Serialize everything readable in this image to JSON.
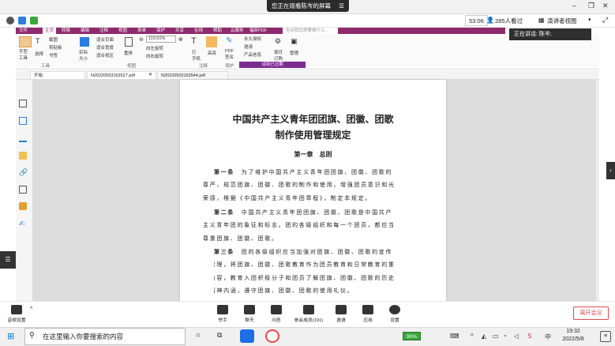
{
  "screen_share": {
    "banner_text": "您正在观看陈岑的屏幕",
    "menu_icon": "menu-icon"
  },
  "meeting_bar": {
    "timer": "53:06",
    "viewers": "285人看过",
    "speaker_view": "演讲者视图",
    "speaking_now": "正在讲话: 陈岑;"
  },
  "pdf_app": {
    "menu": [
      "文件",
      "主页",
      "转换",
      "编辑",
      "注释",
      "视图",
      "表单",
      "保护",
      "共享",
      "在线",
      "帮助",
      "云服务",
      "福昕PDF"
    ],
    "search_placeholder": "告诉我您想要做什么...",
    "ribbon": {
      "hand_tool": "手型\n工具",
      "select": "选择",
      "screenshot": "截图",
      "clipboard": "剪贴板",
      "bookmark": "书签",
      "actual_size": "实际\n大小",
      "fit_page": "适合页面",
      "fit_width": "适合宽度",
      "fit_view": "适合视区",
      "reflow": "重排",
      "zoom_value": "110.51%",
      "rotate_left": "向左旋转",
      "rotate_right": "向右旋转",
      "typewriter": "打\n字机",
      "highlight": "高亮",
      "pdf_sign": "PDF\n签名",
      "permanent_license": "永久授权",
      "invite": "邀请",
      "product_compare": "产品信息",
      "buy_subscribe": "按月\n订购",
      "manage": "管理",
      "group_tools": "工具",
      "group_view": "视图",
      "group_comment": "注释",
      "group_protect": "保护",
      "trial_expired": "试用已过期"
    },
    "tabs": [
      "开始",
      "N20220503163527.pdf",
      "N20220503163544.pdf"
    ]
  },
  "document": {
    "title_line1": "中国共产主义青年团团旗、团徽、团歌",
    "title_line2": "制作使用管理规定",
    "chapter": "第一章　总则",
    "paragraphs": [
      {
        "article": "第一条",
        "lines": [
          "　为了维护中国共产主义青年团团旗、团徽、团歌的",
          "尊严，规范团旗、团徽、团歌的制作和使用，增强团员意识和光",
          "荣感，根据《中国共产主义青年团章程》，制定本规定。"
        ]
      },
      {
        "article": "第二条",
        "lines": [
          "　中国共产主义青年团团旗、团徽、团歌是中国共产",
          "主义青年团的象征和标志。团的各级组织和每一个团员，都应当",
          "尊重团旗、团徽、团歌。"
        ]
      },
      {
        "article": "第三条",
        "lines": [
          "　团的各级组织应当加强对团旗、团徽、团歌的宣传",
          "和管理，将团旗、团徽、团歌教育作为团员教育和日常教育的重",
          "要内容，教育入团积极分子和团员了解团旗、团徽、团歌的历史",
          "和精神内涵，遵守团旗、团徽、团歌的使用礼仪。"
        ]
      }
    ]
  },
  "meeting_tools": {
    "audio_settings": "音频设置",
    "raise_hand": "举手",
    "chat": "聊天",
    "qa": "问答",
    "participants": "参会成员(191)",
    "invite": "邀请",
    "apps": "应用",
    "settings": "设置",
    "leave": "离开会议"
  },
  "taskbar": {
    "search_placeholder": "在这里输入你要搜索的内容",
    "battery": "90%",
    "time": "19:32",
    "date": "2022/5/8"
  }
}
